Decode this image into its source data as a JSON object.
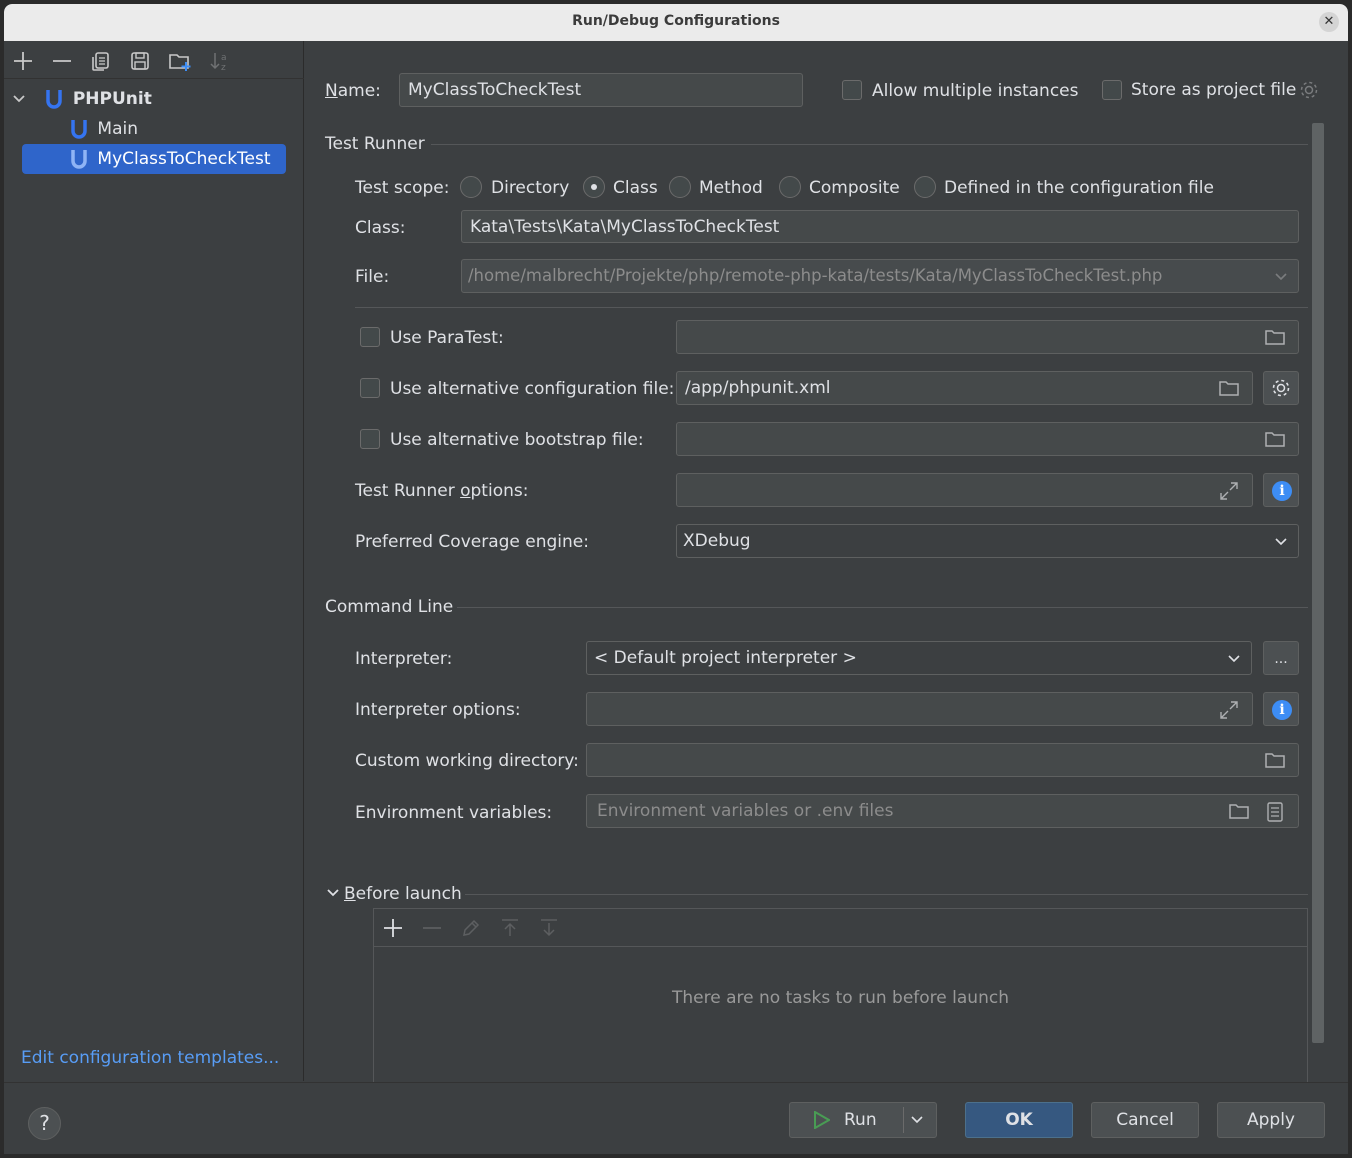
{
  "window": {
    "title": "Run/Debug Configurations"
  },
  "sidebar": {
    "toolbar_icons": [
      "add-icon",
      "remove-icon",
      "copy-icon",
      "save-icon",
      "new-folder-icon",
      "sort-icon"
    ],
    "tree": [
      {
        "label": "PHPUnit",
        "level": 0,
        "expanded": true
      },
      {
        "label": "Main",
        "level": 1
      },
      {
        "label": "MyClassToCheckTest",
        "level": 1,
        "selected": true
      }
    ],
    "edit_templates_link": "Edit configuration templates..."
  },
  "header": {
    "name_label": "Name:",
    "name_value": "MyClassToCheckTest",
    "allow_multiple_label": "Allow multiple instances",
    "allow_multiple_checked": false,
    "store_project_label": "Store as project file",
    "store_project_checked": false
  },
  "test_runner": {
    "section_title": "Test Runner",
    "scope_label": "Test scope:",
    "scopes": [
      {
        "label": "Directory",
        "selected": false
      },
      {
        "label": "Class",
        "selected": true
      },
      {
        "label": "Method",
        "selected": false
      },
      {
        "label": "Composite",
        "selected": false
      },
      {
        "label": "Defined in the configuration file",
        "selected": false
      }
    ],
    "class_label": "Class:",
    "class_value": "Kata\\Tests\\Kata\\MyClassToCheckTest",
    "file_label": "File:",
    "file_value": "/home/malbrecht/Projekte/php/remote-php-kata/tests/Kata/MyClassToCheckTest.php",
    "paratest_label": "Use ParaTest:",
    "paratest_value": "",
    "alt_config_label": "Use alternative configuration file:",
    "alt_config_value": "/app/phpunit.xml",
    "alt_bootstrap_label": "Use alternative bootstrap file:",
    "alt_bootstrap_value": "",
    "options_label_pre": "Test Runner ",
    "options_label_mn": "o",
    "options_label_post": "ptions:",
    "options_value": "",
    "coverage_label": "Preferred Coverage engine:",
    "coverage_value": "XDebug"
  },
  "command_line": {
    "section_title": "Command Line",
    "interpreter_label": "Interpreter:",
    "interpreter_value": "< Default project interpreter >",
    "interpreter_more": "...",
    "interpreter_options_label": "Interpreter options:",
    "interpreter_options_value": "",
    "working_dir_label": "Custom working directory:",
    "working_dir_value": "",
    "env_label": "Environment variables:",
    "env_placeholder": "Environment variables or .env files"
  },
  "before_launch": {
    "title_mn": "B",
    "title_rest": "efore launch",
    "empty_text": "There are no tasks to run before launch"
  },
  "footer": {
    "help": "?",
    "run": "Run",
    "ok": "OK",
    "cancel": "Cancel",
    "apply": "Apply"
  },
  "colors": {
    "accent": "#2f65ca",
    "link": "#589df6",
    "primary_button": "#365880",
    "info": "#3d8df5",
    "run_icon": "#499c54",
    "phpunit_icon": "#3574f0"
  }
}
